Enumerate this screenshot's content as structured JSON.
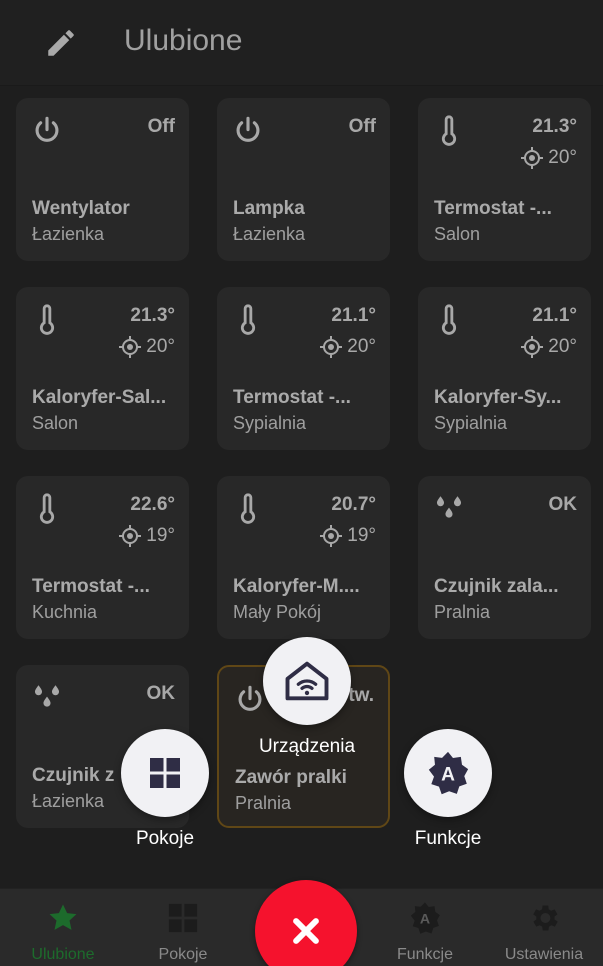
{
  "header": {
    "title": "Ulubione"
  },
  "cards": [
    {
      "kind": "power",
      "state": "Off",
      "name": "Wentylator",
      "room": "Łazienka"
    },
    {
      "kind": "power",
      "state": "Off",
      "name": "Lampka",
      "room": "Łazienka"
    },
    {
      "kind": "thermo",
      "state": "21.3°",
      "target": "20°",
      "name": "Termostat -...",
      "room": "Salon"
    },
    {
      "kind": "thermo",
      "state": "21.3°",
      "target": "20°",
      "name": "Kaloryfer-Sal...",
      "room": "Salon"
    },
    {
      "kind": "thermo",
      "state": "21.1°",
      "target": "20°",
      "name": "Termostat -...",
      "room": "Sypialnia"
    },
    {
      "kind": "thermo",
      "state": "21.1°",
      "target": "20°",
      "name": "Kaloryfer-Sy...",
      "room": "Sypialnia"
    },
    {
      "kind": "thermo",
      "state": "22.6°",
      "target": "19°",
      "name": "Termostat -...",
      "room": "Kuchnia"
    },
    {
      "kind": "thermo",
      "state": "20.7°",
      "target": "19°",
      "name": "Kaloryfer-M....",
      "room": "Mały Pokój"
    },
    {
      "kind": "water",
      "state": "OK",
      "name": "Czujnik zala...",
      "room": "Pralnia"
    },
    {
      "kind": "water",
      "state": "OK",
      "name": "Czujnik z",
      "room": "Łazienka"
    },
    {
      "kind": "power",
      "state": "tw.",
      "name": "Zawór pralki",
      "room": "Pralnia"
    }
  ],
  "fab_menu": {
    "devices": "Urządzenia",
    "rooms": "Pokoje",
    "functions": "Funkcje"
  },
  "bottom_nav": [
    {
      "label": "Ulubione",
      "icon": "star-icon",
      "selected": true
    },
    {
      "label": "Pokoje",
      "icon": "grid-icon"
    },
    {
      "label": "Funkcje",
      "icon": "function-badge-icon"
    },
    {
      "label": "Ustawienia",
      "icon": "gear-icon"
    }
  ],
  "colors": {
    "accent_selected": "#1d6b2c",
    "close_button": "#f5122d",
    "active_border": "#8a6620"
  }
}
